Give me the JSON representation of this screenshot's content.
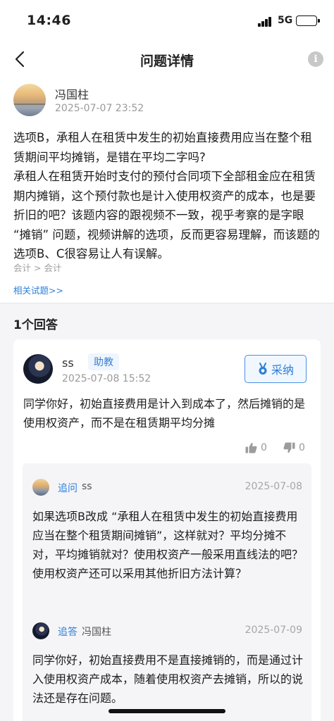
{
  "status_bar": {
    "time": "14:46",
    "network": "5G"
  },
  "nav": {
    "title": "问题详情",
    "back_icon": "chevron-left-icon",
    "info_icon": "info-icon",
    "info_glyph": "i"
  },
  "question": {
    "author": "冯国柱",
    "time": "2025-07-07 23:52",
    "paragraphs": [
      "选项B，承租人在租赁中发生的初始直接费用应当在整个租赁期间平均摊销，是错在平均二字吗?",
      "承租人在租赁开始时支付的预付合同项下全部租金应在租赁期内摊销，这个预付款也是计入使用权资产的成本，也是要折旧的吧？该题内容的跟视频不一致，视乎考察的是字眼 “摊销” 问题，视频讲解的选项，反而更容易理解，而该题的选项B、C很容易让人有误解。"
    ],
    "breadcrumb": "会计 > 会计",
    "related_link": "相关试题>>"
  },
  "answers_header": "1个回答",
  "answer": {
    "author": "ss",
    "badge": "助教",
    "time": "2025-07-08 15:52",
    "adopt_label": "采纳",
    "text": "同学你好，初始直接费用是计入到成本了，然后摊销的是使用权资产，而不是在租赁期平均分摊",
    "likes": "0",
    "dislikes": "0"
  },
  "thread": [
    {
      "label": "追问",
      "user": "ss",
      "date": "2025-07-08",
      "text": "如果选项B改成 “承租人在租赁中发生的初始直接费用应当在整个租赁期间摊销”，这样就对？平均分摊不对，平均摊销就对？使用权资产一般采用直线法的吧？使用权资产还可以采用其他折旧方法计算？"
    },
    {
      "label": "追答",
      "user": "冯国柱",
      "date": "2025-07-09",
      "text": "同学你好，初始直接费用不是直接摊销的，而是通过计入使用权资产成本，随着使用权资产去摊销，所以的说法还是存在问题。"
    }
  ],
  "colors": {
    "accent": "#2d7fd8",
    "muted": "#9a9a9a",
    "background_gray": "#f5f5f7"
  }
}
